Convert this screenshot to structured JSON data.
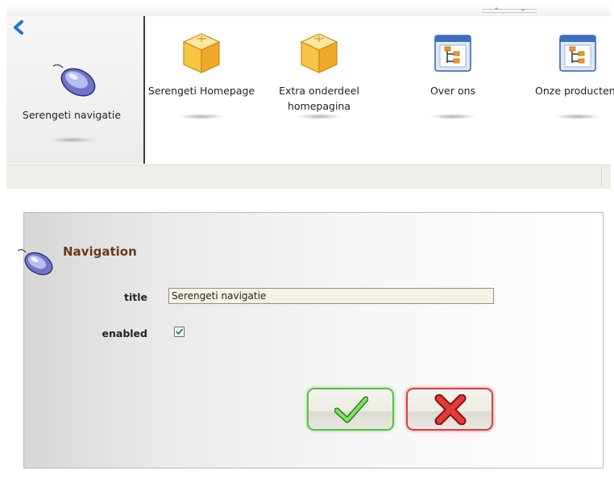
{
  "navigator": {
    "back_icon": "chevron-left-icon",
    "current": {
      "label": "Serengeti navigatie",
      "icon": "mouse-icon"
    },
    "items": [
      {
        "label": "Serengeti Homepage",
        "icon": "box-icon"
      },
      {
        "label": "Extra onderdeel homepagina",
        "icon": "box-icon"
      },
      {
        "label": "Over ons",
        "icon": "sitemap-window-icon"
      },
      {
        "label": "Onze producten",
        "icon": "sitemap-window-icon"
      }
    ]
  },
  "form": {
    "title": "Navigation",
    "icon": "mouse-icon",
    "fields": {
      "title_label": "title",
      "title_value": "Serengeti navigatie",
      "enabled_label": "enabled",
      "enabled_checked": true
    },
    "ok_icon": "checkmark-icon",
    "cancel_icon": "x-icon"
  },
  "colors": {
    "form_title": "#6b3a13",
    "ok_border": "#59c04b",
    "cancel_border": "#d34343",
    "back_arrow": "#2a6fd6"
  }
}
